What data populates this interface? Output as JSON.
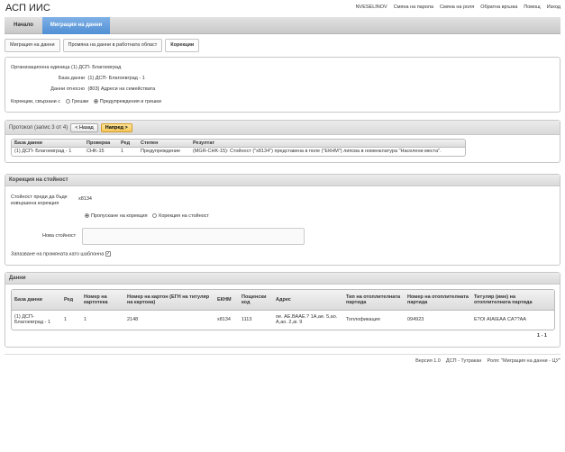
{
  "app": {
    "title": "АСП ИИС"
  },
  "toplinks": [
    "NVESELINOV",
    "Смяна на парола",
    "Смяна на роля",
    "Обратна връзка",
    "Помощ",
    "Изход"
  ],
  "nav": {
    "home": "Начало",
    "active": "Миграция на данни"
  },
  "breadcrumb": [
    "Миграция на данни",
    "Промяна на данни в работната област",
    "Корекции"
  ],
  "info": {
    "org_label": "Организационна единица",
    "org_value": "(1) ДСП- Благоевград",
    "db_label": "База данни",
    "db_value": "(1) ДСП- Благоевград - 1",
    "data_label": "Данни относно",
    "data_value": "(803) Адреси на семействата",
    "corr_label": "Корекции, свързани с",
    "corr_opt1": "Грешки",
    "corr_opt2": "Предупреждения и грешки",
    "corr_selected": "Предупреждения и грешки"
  },
  "protocol": {
    "title": "Протокол (запис 3 от 4)",
    "back_label": "< Назад",
    "next_label": "Напред >",
    "columns": [
      "База данни",
      "Проверка",
      "Ред",
      "Степен",
      "Резултат"
    ],
    "rows": [
      [
        "(1) ДСП- Благоевград - 1",
        "CHK-15",
        "1",
        "Предупреждение",
        "(MGR-CHK-15): Стойност (\"x8134\") представена в поле (\"ЕКНМ\") липсва в номенклатура \"Населени места\"."
      ]
    ]
  },
  "correction": {
    "title": "Корекция на стойност",
    "before_label": "Стойност преди да бъде извършена корекция",
    "before_value": "x8134",
    "opt_skip": "Пропускане на корекция",
    "opt_correct": "Корекция на стойност",
    "selected": "Пропускане на корекция",
    "new_label": "Нова стойност",
    "new_value": "",
    "save_label": "Запазване на промяната като шаблонна",
    "save_checked": true
  },
  "data": {
    "title": "Данни",
    "columns": [
      "База данни",
      "Ред",
      "Номер на картотека",
      "Номер на картон (ЕГН на титуляр на картона)",
      "ЕКНМ",
      "Пощенски код",
      "Адрес",
      "Тип на отоплителната партида",
      "Номер на отоплителната партида",
      "Титуляр (име) на отоплителната партида"
    ],
    "rows": [
      [
        "(1) ДСП- Благоевград - 1",
        "1",
        "1",
        "2148",
        "x8134",
        "1113",
        "ое. АЕ.ВААЕ.? 1А,ае. 5,ао. А,ао. 2,аі. 9",
        "Топлофикация",
        "094923",
        "Е?ОІ АІАІЕАА СА??АА"
      ]
    ],
    "pager": "1 - 1"
  },
  "footer": [
    "Версия 1.0",
    "ДСП - Тутракан",
    "Роля: \"Миграция на данни - ЦУ\""
  ]
}
